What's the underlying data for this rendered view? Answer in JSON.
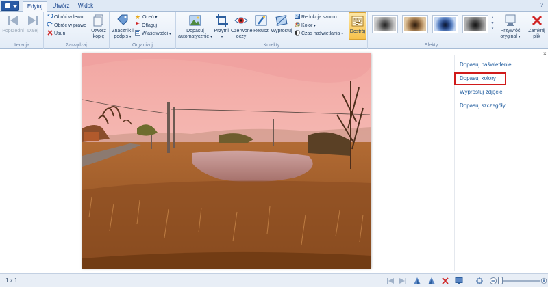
{
  "tabs": {
    "file_menu": "",
    "edit": "Edytuj",
    "create": "Utwórz",
    "view": "Widok"
  },
  "window": {
    "help": "?"
  },
  "ribbon": {
    "navigation": {
      "previous": "Poprzedni",
      "next": "Dalej",
      "label": "Iteracja"
    },
    "manage": {
      "rotate_left": "Obróć w lewo",
      "rotate_right": "Obróć w prawo",
      "delete": "Usuń",
      "copy_line1": "Utwórz",
      "copy_line2": "kopię",
      "label": "Zarządzaj"
    },
    "organize": {
      "tag_line1": "Znacznik i",
      "tag_line2": "podpis",
      "rate": "Oceń",
      "flag": "Oflaguj",
      "properties": "Właściwości",
      "label": "Organizuj"
    },
    "adjust": {
      "auto_line1": "Dopasuj",
      "auto_line2": "automatycznie",
      "crop": "Przytnij",
      "redeye_line1": "Czerwone",
      "redeye_line2": "oczy",
      "retouch": "Retusz",
      "straighten": "Wyprostuj",
      "noise": "Redukcja szumu",
      "color": "Kolor",
      "exposure": "Czas naświetlania",
      "fine_tune": "Dostrój",
      "label": "Korekty"
    },
    "effects": {
      "label": "Efekty"
    },
    "revert": {
      "line1": "Przywróć",
      "line2": "oryginał"
    },
    "close": {
      "line1": "Zamknij",
      "line2": "plik"
    }
  },
  "side_panel": {
    "items": [
      "Dopasuj naświetlenie",
      "Dopasuj kolory",
      "Wyprostuj zdjęcie",
      "Dopasuj szczegóły"
    ],
    "highlighted": "Dopasuj kolory",
    "close": "×"
  },
  "status": {
    "position": "1 z 1"
  },
  "colors": {
    "accent_highlight": "#d01a1a",
    "ribbon_bg": "#e3ecf7",
    "link": "#1e5b9e",
    "active_button": "#f7c24b"
  }
}
